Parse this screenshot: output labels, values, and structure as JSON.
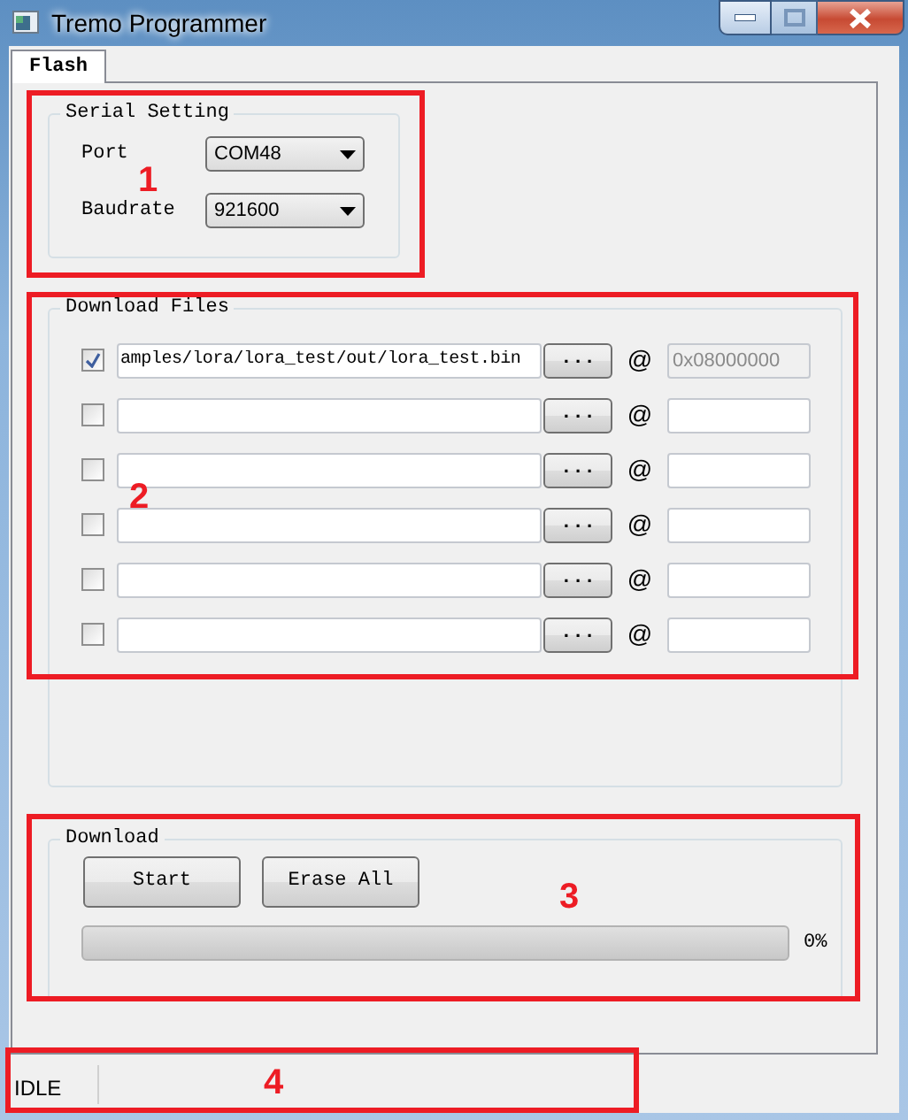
{
  "window": {
    "title": "Tremo Programmer"
  },
  "tabs": [
    {
      "label": "Flash",
      "selected": true
    }
  ],
  "serial_setting": {
    "title": "Serial Setting",
    "fields": [
      {
        "label": "Port",
        "value": "COM48"
      },
      {
        "label": "Baudrate",
        "value": "921600"
      }
    ]
  },
  "download_files": {
    "title": "Download Files",
    "rows": [
      {
        "checked": true,
        "path": "amples/lora/lora_test/out/lora_test.bin",
        "browse": "...",
        "at": "@",
        "address": "0x08000000",
        "disabled": true
      },
      {
        "checked": false,
        "path": "",
        "browse": "...",
        "at": "@",
        "address": "",
        "disabled": false
      },
      {
        "checked": false,
        "path": "",
        "browse": "...",
        "at": "@",
        "address": "",
        "disabled": false
      },
      {
        "checked": false,
        "path": "",
        "browse": "...",
        "at": "@",
        "address": "",
        "disabled": false
      },
      {
        "checked": false,
        "path": "",
        "browse": "...",
        "at": "@",
        "address": "",
        "disabled": false
      },
      {
        "checked": false,
        "path": "",
        "browse": "...",
        "at": "@",
        "address": "",
        "disabled": false
      }
    ]
  },
  "download": {
    "title": "Download",
    "buttons": [
      "Start",
      "Erase All"
    ],
    "progress": {
      "level": 0,
      "reading": "0%"
    }
  },
  "status_bar": {
    "text": "IDLE"
  },
  "annotations": [
    {
      "label": "1"
    },
    {
      "label": "2"
    },
    {
      "label": "3"
    },
    {
      "label": "4"
    }
  ]
}
